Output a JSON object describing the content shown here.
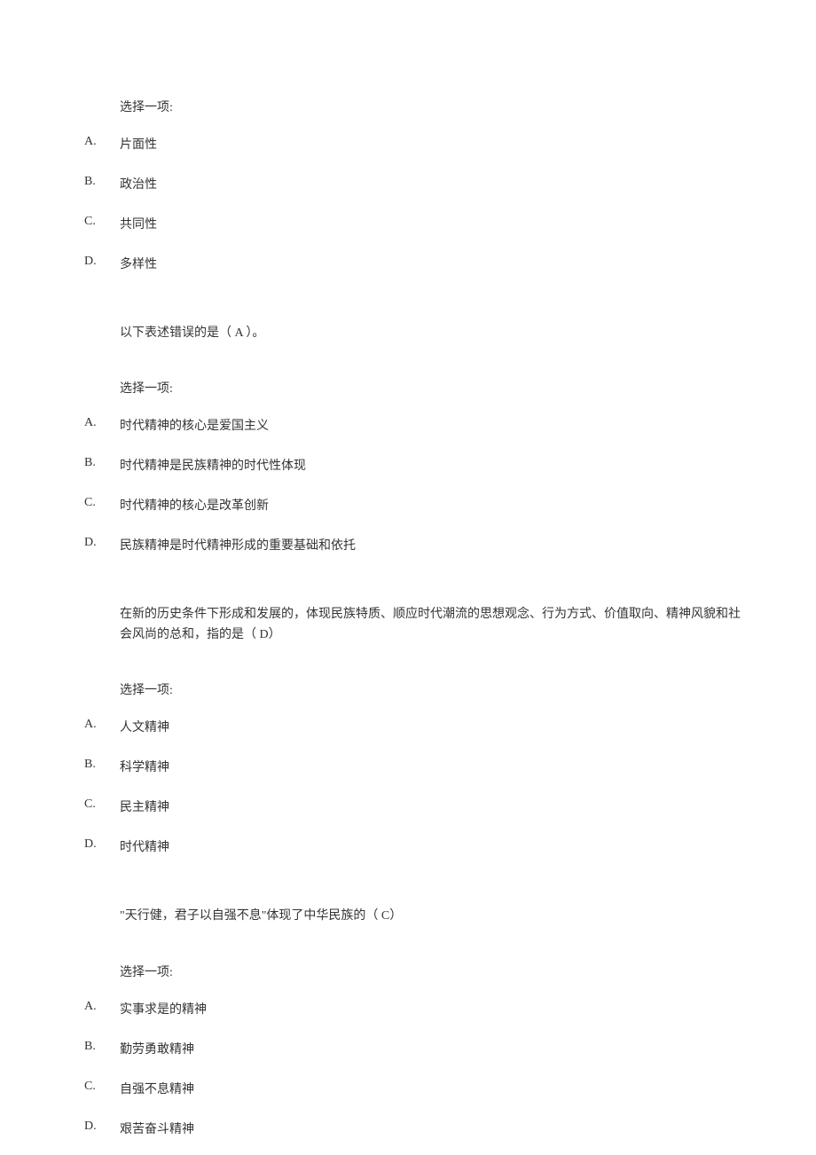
{
  "questions": [
    {
      "prompt": "选择一项:",
      "options": [
        {
          "label": "A.",
          "text": "片面性"
        },
        {
          "label": "B.",
          "text": "政治性"
        },
        {
          "label": "C.",
          "text": "共同性"
        },
        {
          "label": "D.",
          "text": "多样性"
        }
      ]
    },
    {
      "question_text": "以下表述错误的是（   A  ）。",
      "prompt": "选择一项:",
      "options": [
        {
          "label": "A.",
          "text": "时代精神的核心是爱国主义"
        },
        {
          "label": "B.",
          "text": "时代精神是民族精神的时代性体现"
        },
        {
          "label": "C.",
          "text": "时代精神的核心是改革创新"
        },
        {
          "label": "D.",
          "text": "民族精神是时代精神形成的重要基础和依托"
        }
      ]
    },
    {
      "question_text": "在新的历史条件下形成和发展的，体现民族特质、顺应时代潮流的思想观念、行为方式、价值取向、精神风貌和社会风尚的总和，指的是（   D）",
      "prompt": "选择一项:",
      "options": [
        {
          "label": "A.",
          "text": "人文精神"
        },
        {
          "label": "B.",
          "text": "科学精神"
        },
        {
          "label": "C.",
          "text": "民主精神"
        },
        {
          "label": "D.",
          "text": "时代精神"
        }
      ]
    },
    {
      "question_text": "\"天行健，君子以自强不息\"体现了中华民族的（   C）",
      "prompt": "选择一项:",
      "options": [
        {
          "label": "A.",
          "text": "实事求是的精神"
        },
        {
          "label": "B.",
          "text": "勤劳勇敢精神"
        },
        {
          "label": "C.",
          "text": "自强不息精神"
        },
        {
          "label": "D.",
          "text": "艰苦奋斗精神"
        }
      ]
    }
  ]
}
